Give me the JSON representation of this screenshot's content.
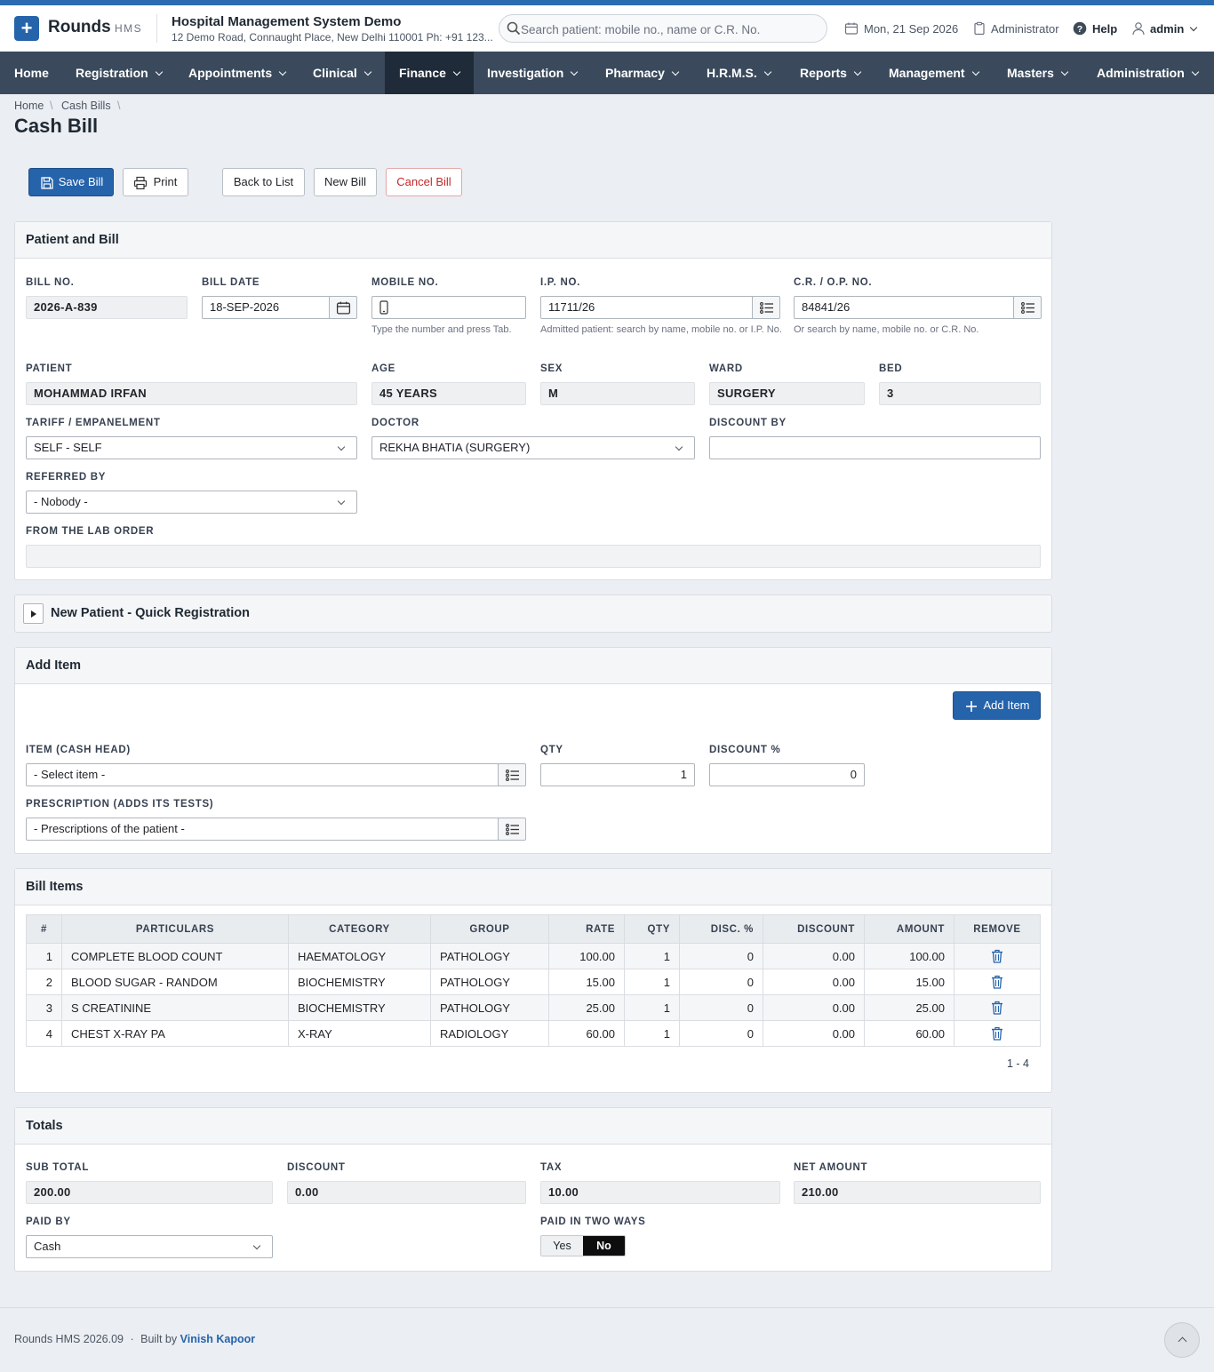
{
  "brand": {
    "name": "Rounds",
    "sub": "HMS"
  },
  "hospital": {
    "name": "Hospital Management System Demo",
    "address": "12 Demo Road, Connaught Place, New Delhi 110001 Ph: +91 123..."
  },
  "search": {
    "placeholder": "Search patient: mobile no., name or C.R. No."
  },
  "header": {
    "date": "Mon, 21 Sep 2026",
    "role": "Administrator",
    "help": "Help",
    "user": "admin"
  },
  "nav": [
    {
      "label": "Home"
    },
    {
      "label": "Registration"
    },
    {
      "label": "Appointments"
    },
    {
      "label": "Clinical"
    },
    {
      "label": "Finance",
      "active": true
    },
    {
      "label": "Investigation"
    },
    {
      "label": "Pharmacy"
    },
    {
      "label": "H.R.M.S."
    },
    {
      "label": "Reports"
    },
    {
      "label": "Management"
    },
    {
      "label": "Masters"
    },
    {
      "label": "Administration"
    }
  ],
  "breadcrumb": [
    "Home",
    "Cash Bills"
  ],
  "page_title": "Cash Bill",
  "actions": {
    "save": "Save Bill",
    "print": "Print",
    "back": "Back to List",
    "new": "New Bill",
    "cancel": "Cancel Bill"
  },
  "patient_bill": {
    "title": "Patient and Bill",
    "bill_no_label": "BILL NO.",
    "bill_no": "2026-A-839",
    "bill_date_label": "BILL DATE",
    "bill_date": "18-SEP-2026",
    "mobile_label": "MOBILE NO.",
    "mobile": "",
    "mobile_help": "Type the number and press Tab.",
    "ip_label": "I.P. NO.",
    "ip": "11711/26",
    "ip_help": "Admitted patient: search by name, mobile no. or I.P. No.",
    "cr_label": "C.R. / O.P. NO.",
    "cr": "84841/26",
    "cr_help": "Or search by name, mobile no. or C.R. No.",
    "patient_label": "PATIENT",
    "patient": "MOHAMMAD IRFAN",
    "age_label": "AGE",
    "age": "45 YEARS",
    "sex_label": "SEX",
    "sex": "M",
    "ward_label": "WARD",
    "ward": "SURGERY",
    "bed_label": "BED",
    "bed": "3",
    "tariff_label": "TARIFF / EMPANELMENT",
    "tariff": "SELF - SELF",
    "doctor_label": "DOCTOR",
    "doctor": "REKHA BHATIA (SURGERY)",
    "discount_by_label": "DISCOUNT BY",
    "discount_by": "",
    "referred_label": "REFERRED BY",
    "referred": "- Nobody -",
    "lab_order_label": "FROM THE LAB ORDER",
    "lab_order": ""
  },
  "quick_reg": {
    "title": "New Patient - Quick Registration"
  },
  "add_item": {
    "title": "Add Item",
    "button": "Add Item",
    "item_label": "ITEM (CASH HEAD)",
    "item": "- Select item -",
    "qty_label": "QTY",
    "qty": "1",
    "disc_label": "DISCOUNT %",
    "disc": "0",
    "rx_label": "PRESCRIPTION (ADDS ITS TESTS)",
    "rx": "- Prescriptions of the patient -"
  },
  "bill_items": {
    "title": "Bill Items",
    "columns": [
      "#",
      "PARTICULARS",
      "CATEGORY",
      "GROUP",
      "RATE",
      "QTY",
      "DISC. %",
      "DISCOUNT",
      "AMOUNT",
      "REMOVE"
    ],
    "rows": [
      {
        "no": "1",
        "particulars": "COMPLETE BLOOD COUNT",
        "category": "HAEMATOLOGY",
        "group": "PATHOLOGY",
        "rate": "100.00",
        "qty": "1",
        "disc_pct": "0",
        "discount": "0.00",
        "amount": "100.00"
      },
      {
        "no": "2",
        "particulars": "BLOOD SUGAR - RANDOM",
        "category": "BIOCHEMISTRY",
        "group": "PATHOLOGY",
        "rate": "15.00",
        "qty": "1",
        "disc_pct": "0",
        "discount": "0.00",
        "amount": "15.00"
      },
      {
        "no": "3",
        "particulars": "S CREATININE",
        "category": "BIOCHEMISTRY",
        "group": "PATHOLOGY",
        "rate": "25.00",
        "qty": "1",
        "disc_pct": "0",
        "discount": "0.00",
        "amount": "25.00"
      },
      {
        "no": "4",
        "particulars": "CHEST X-RAY PA",
        "category": "X-RAY",
        "group": "RADIOLOGY",
        "rate": "60.00",
        "qty": "1",
        "disc_pct": "0",
        "discount": "0.00",
        "amount": "60.00"
      }
    ],
    "pager": "1 - 4"
  },
  "totals": {
    "title": "Totals",
    "sub_total_label": "SUB TOTAL",
    "sub_total": "200.00",
    "discount_label": "DISCOUNT",
    "discount": "0.00",
    "tax_label": "TAX",
    "tax": "10.00",
    "net_label": "NET AMOUNT",
    "net": "210.00",
    "paid_by_label": "PAID BY",
    "paid_by": "Cash",
    "two_ways_label": "PAID IN TWO WAYS",
    "yes": "Yes",
    "no": "No"
  },
  "footer": {
    "version": "Rounds HMS 2026.09",
    "sep": "·",
    "built_by": "Built by",
    "author": "Vinish Kapoor"
  },
  "colors": {
    "primary": "#2563ab",
    "nav_bg": "#3a4a5c",
    "nav_active": "#1f2b38",
    "danger": "#c62828"
  }
}
